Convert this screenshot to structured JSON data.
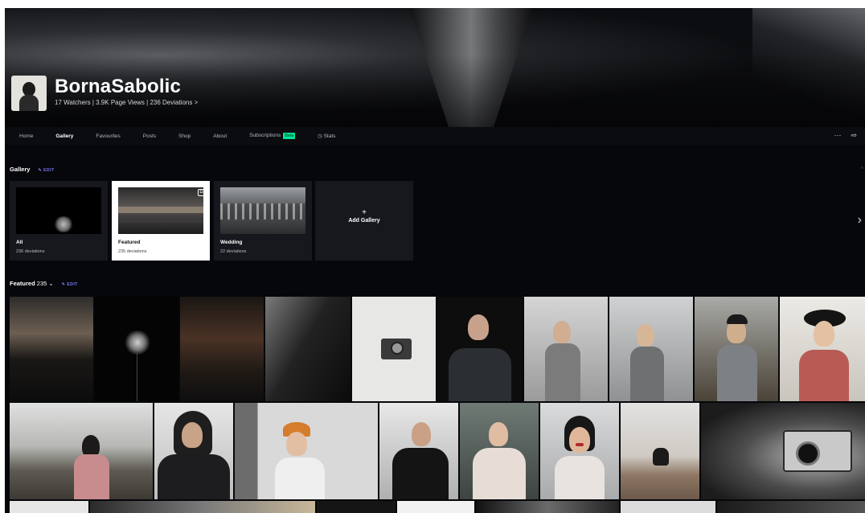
{
  "profile": {
    "username": "BornaSabolic",
    "stats": "17 Watchers  |  3.9K Page Views  |  236 Deviations  >"
  },
  "nav": {
    "items": [
      "Home",
      "Gallery",
      "Favourites",
      "Posts",
      "Shop",
      "About",
      "Subscriptions",
      "Stats"
    ],
    "beta_badge": "Beta",
    "more_glyph": "···",
    "share_glyph": "⇨"
  },
  "gallery_section": {
    "title": "Gallery",
    "edit_label": "EDIT",
    "cards": [
      {
        "name": "All",
        "count": "236 deviations"
      },
      {
        "name": "Featured",
        "count": "235 deviations"
      },
      {
        "name": "Wedding",
        "count": "22 deviations"
      }
    ],
    "add_label": "Add Gallery",
    "add_plus": "+"
  },
  "featured_section": {
    "title": "Featured",
    "count": "235",
    "edit_label": "EDIT"
  },
  "colors": {
    "accent": "#7f7bff",
    "beta": "#00e59b",
    "background": "#06070a",
    "card": "#16181d"
  }
}
